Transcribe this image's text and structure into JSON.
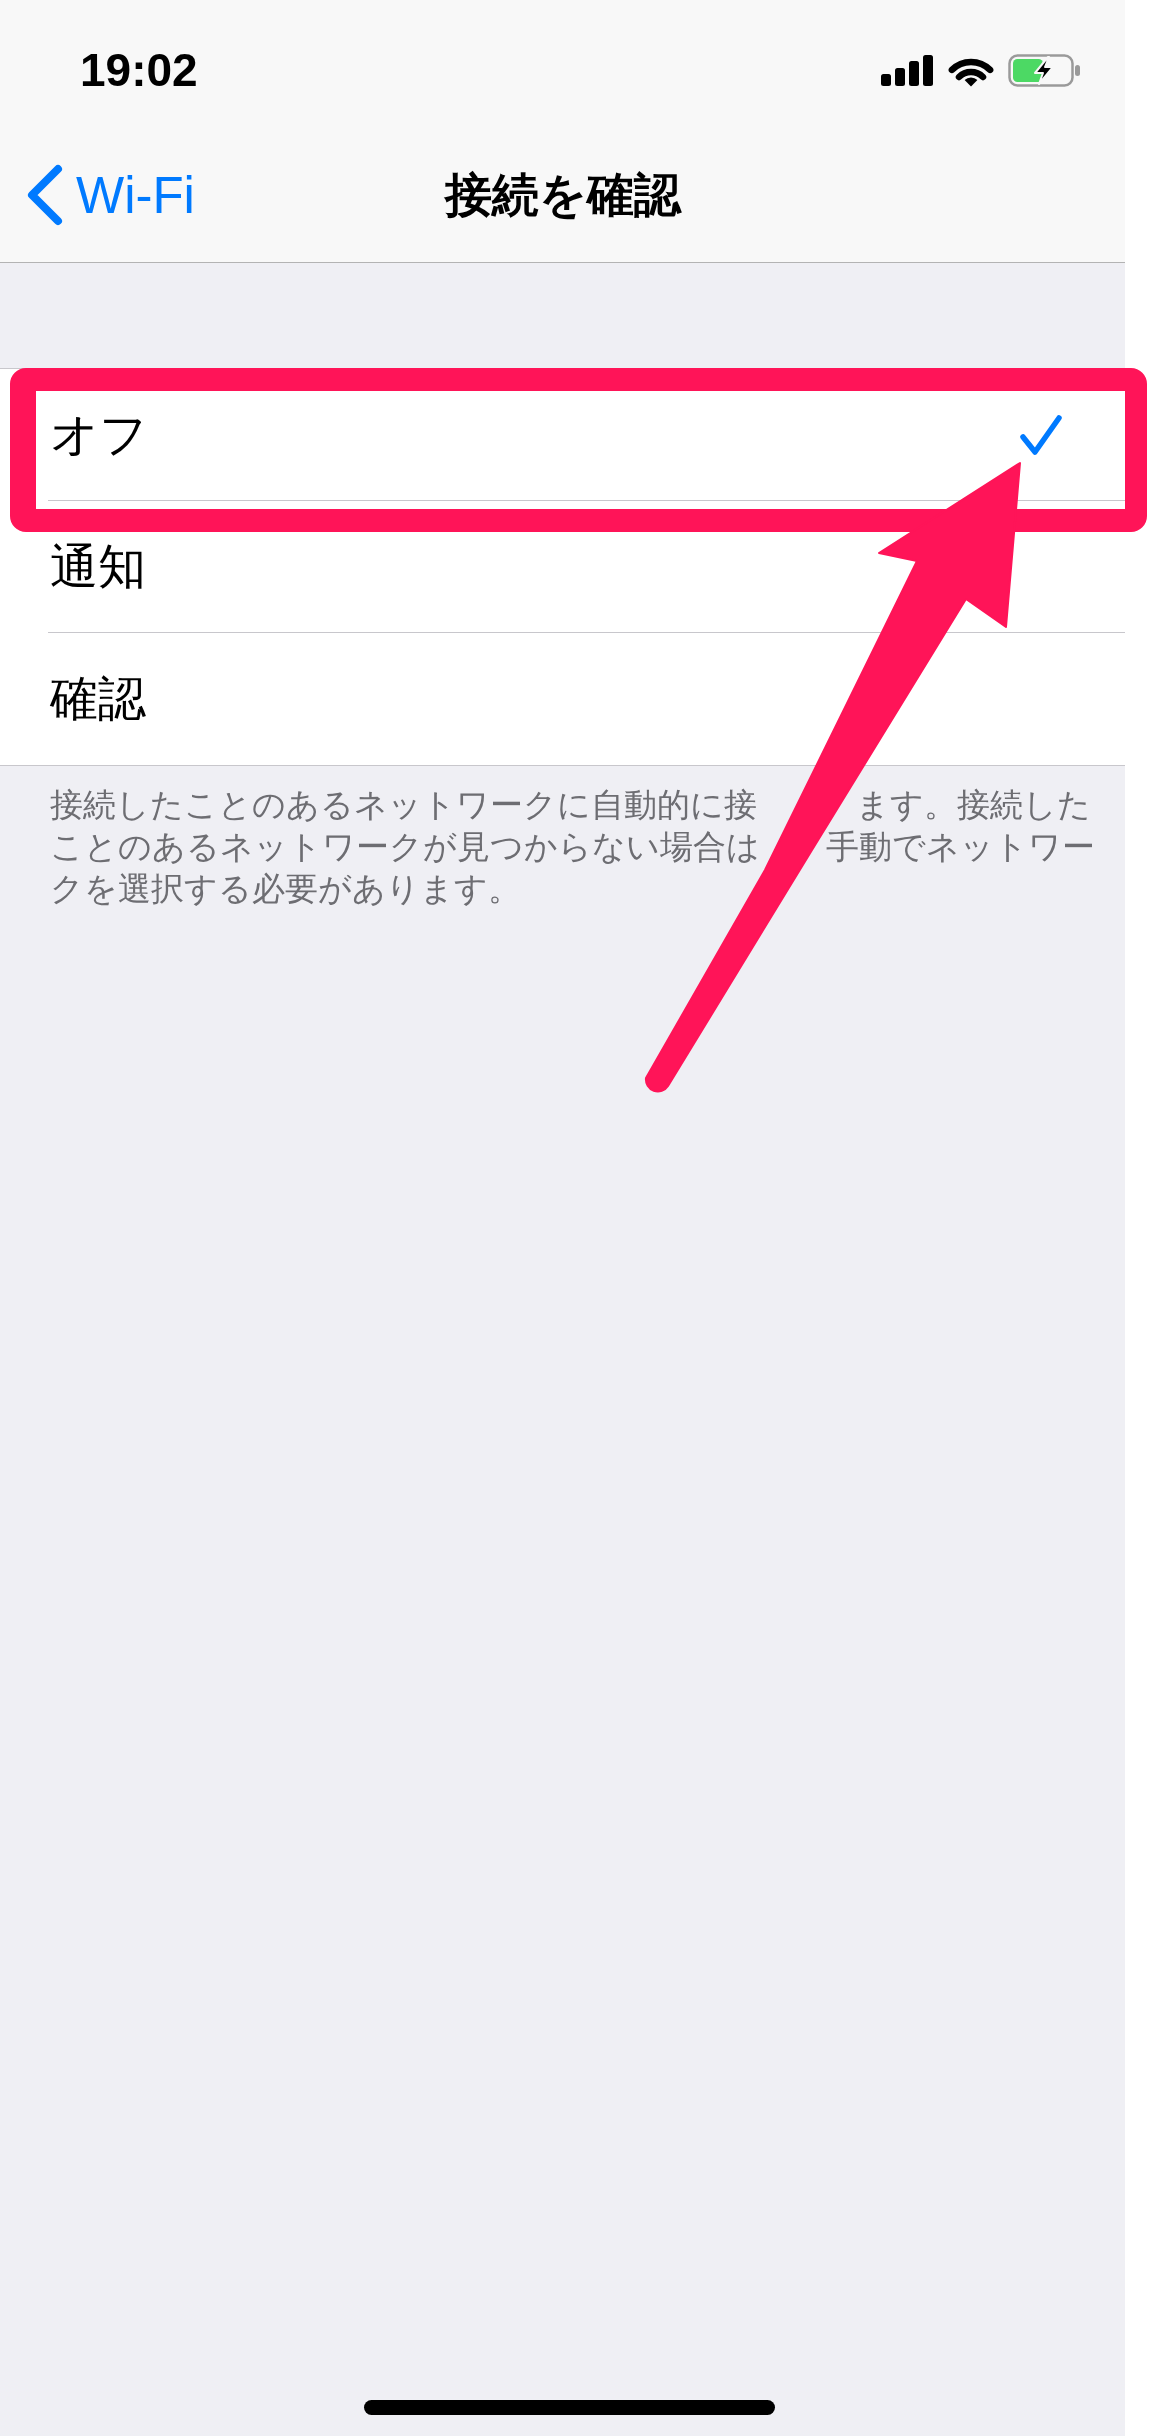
{
  "status_bar": {
    "time": "19:02"
  },
  "nav_bar": {
    "back_label": "Wi-Fi",
    "title": "接続を確認"
  },
  "options": [
    {
      "label": "オフ",
      "selected": true
    },
    {
      "label": "通知",
      "selected": false
    },
    {
      "label": "確認",
      "selected": false
    }
  ],
  "footer": "接続したことのあるネットワークに自動的に接　　　ます。接続したことのあるネットワークが見つからない場合は　　手動でネットワークを選択する必要があります。",
  "annotations": {
    "highlight_frame": true,
    "arrow": true
  }
}
